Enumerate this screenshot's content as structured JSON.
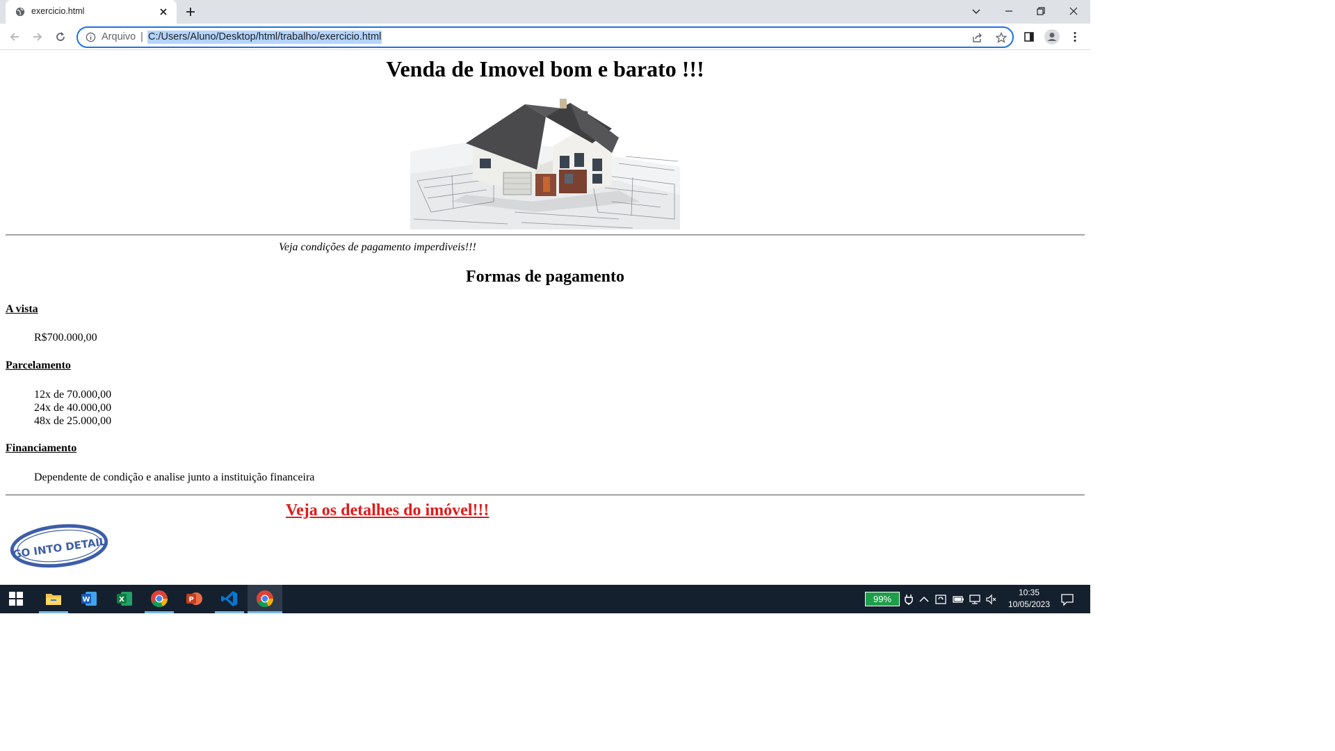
{
  "browser": {
    "tab_title": "exercicio.html",
    "omnibox_scheme": "Arquivo",
    "omnibox_separator": "|",
    "url": "C:/Users/Aluno/Desktop/html/trabalho/exercicio.html",
    "accent_color": "#1a73e8"
  },
  "page": {
    "heading": "Venda de Imovel bom e barato !!!",
    "promo_text": "Veja condições de pagamento imperdiveis!!!",
    "payment_heading": "Formas de pagamento",
    "sections": {
      "avista_title": "A vista",
      "avista_value": "R$700.000,00",
      "parcelamento_title": "Parcelamento",
      "parcelamento_items": [
        "12x de 70.000,00",
        "24x de 40.000,00",
        "48x de 25.000,00"
      ],
      "financiamento_title": "Financiamento",
      "financiamento_text": "Dependente de condição e analise junto a instituição financeira"
    },
    "details_link": "Veja os detalhes do imóvel!!!",
    "link_color": "#e01b1b",
    "stamp_text": "GO INTO DETAIL"
  },
  "taskbar": {
    "battery": "99%",
    "time": "10:35",
    "date": "10/05/2023",
    "apps": [
      "windows-start",
      "file-explorer",
      "word",
      "excel",
      "chrome",
      "powerpoint",
      "vscode",
      "chrome-active"
    ]
  }
}
